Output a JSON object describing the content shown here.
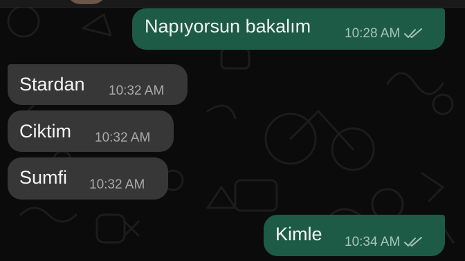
{
  "chat": {
    "messages": [
      {
        "id": "m1",
        "direction": "outgoing",
        "text": "Napıyorsun bakalım",
        "time": "10:28 AM",
        "status": "read"
      },
      {
        "id": "m2",
        "direction": "incoming",
        "text": "Stardan",
        "time": "10:32 AM"
      },
      {
        "id": "m3",
        "direction": "incoming",
        "text": "Ciktim",
        "time": "10:32 AM"
      },
      {
        "id": "m4",
        "direction": "incoming",
        "text": "Sumfi",
        "time": "10:32 AM"
      },
      {
        "id": "m5",
        "direction": "outgoing",
        "text": "Kimle",
        "time": "10:34 AM",
        "status": "read"
      }
    ]
  },
  "icons": {
    "read_receipt": "double-check-icon",
    "avatar": "avatar"
  },
  "colors": {
    "outgoing_bubble": "#1d5b47",
    "incoming_bubble": "#373737",
    "background": "#0b0b0b"
  }
}
